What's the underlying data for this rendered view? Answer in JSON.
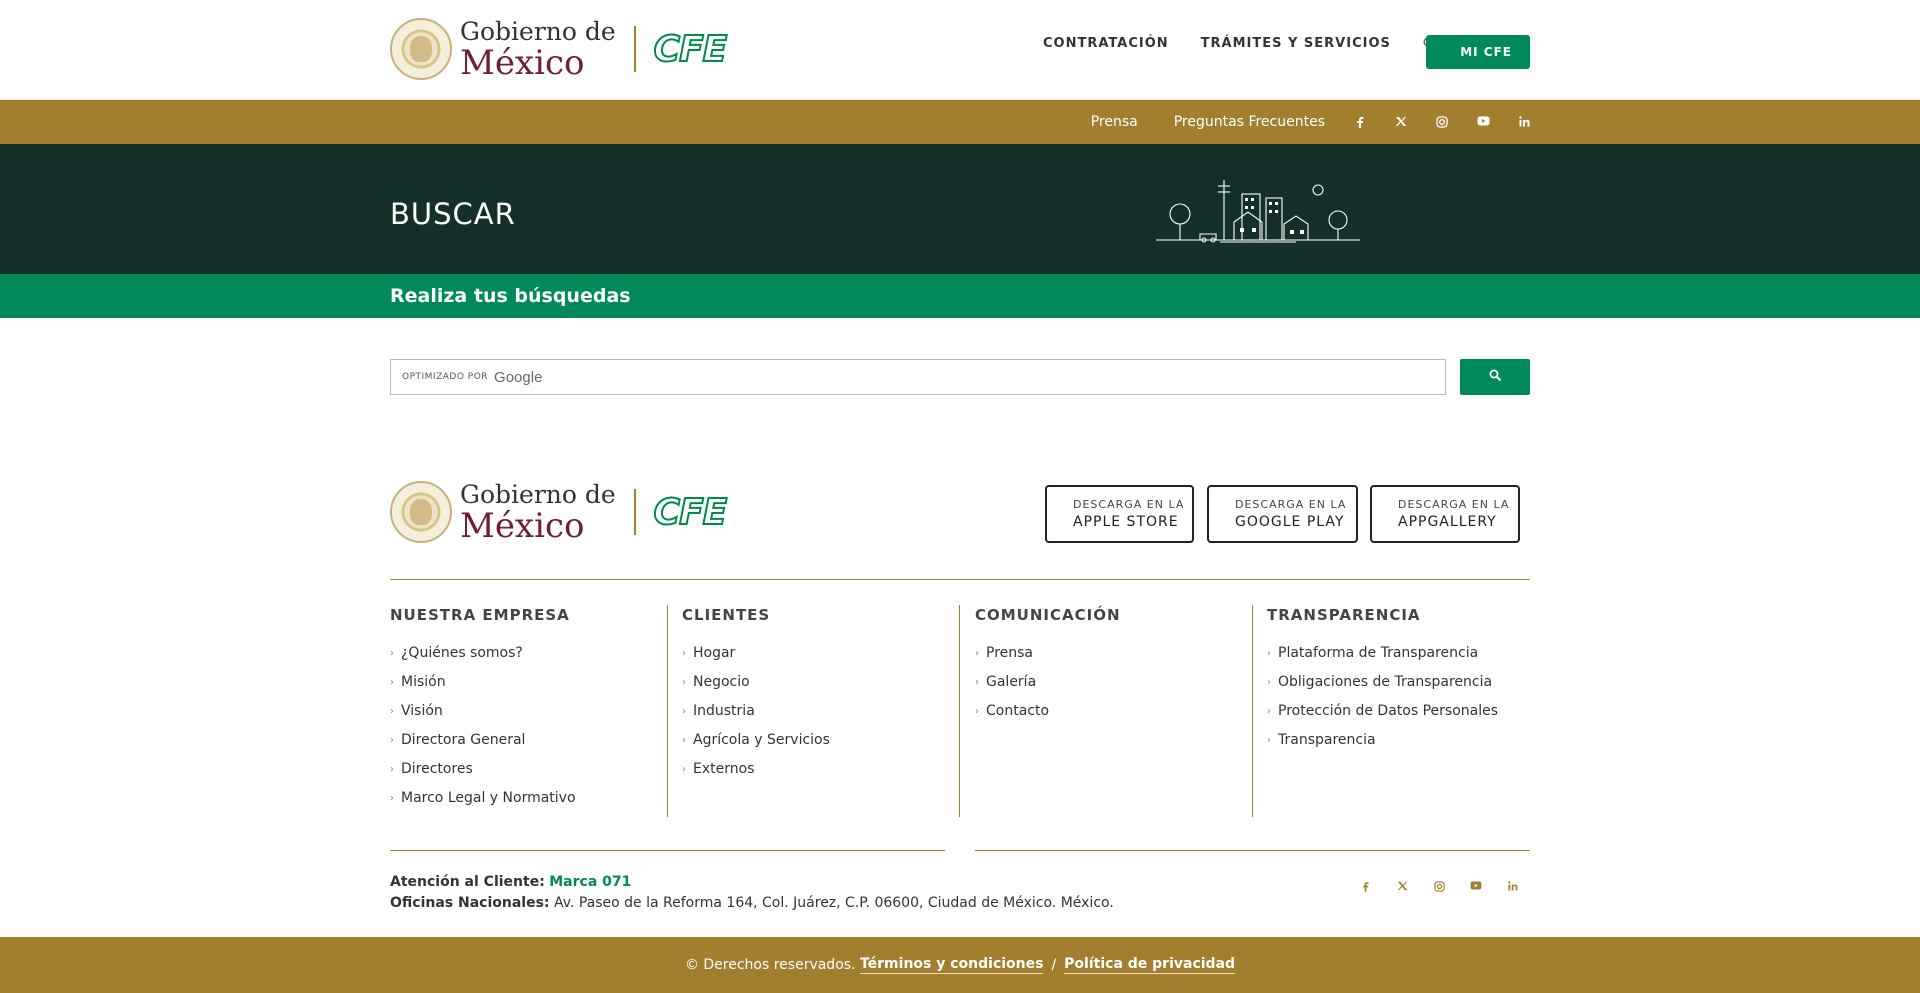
{
  "header": {
    "gob_line1": "Gobierno de",
    "gob_line2": "México",
    "cfe_logo": "CFE",
    "nav": [
      "CONTRATACIÓN",
      "TRÁMITES Y SERVICIOS"
    ],
    "search_icon": "search-icon",
    "mi_cfe": "MI CFE"
  },
  "goldbar": {
    "links": [
      "Prensa",
      "Preguntas Frecuentes"
    ],
    "social_icons": [
      "facebook-icon",
      "twitter-icon",
      "instagram-icon",
      "youtube-icon",
      "linkedin-icon"
    ]
  },
  "hero": {
    "title": "BUSCAR"
  },
  "subheader": {
    "title": "Realiza tus búsquedas"
  },
  "search": {
    "powered_by": "OPTIMIZADO POR",
    "brand": "Google",
    "button_icon": "search-icon"
  },
  "apps": [
    {
      "small": "DESCARGA EN LA",
      "big": "APPLE STORE"
    },
    {
      "small": "DESCARGA EN LA",
      "big": "GOOGLE PLAY"
    },
    {
      "small": "DESCARGA EN LA",
      "big": "APPGALLERY"
    }
  ],
  "footer_columns": [
    {
      "title": "NUESTRA EMPRESA",
      "items": [
        "¿Quiénes somos?",
        "Misión",
        "Visión",
        "Directora General",
        "Directores",
        "Marco Legal y Normativo"
      ]
    },
    {
      "title": "CLIENTES",
      "items": [
        "Hogar",
        "Negocio",
        "Industria",
        "Agrícola y Servicios",
        "Externos"
      ]
    },
    {
      "title": "COMUNICACIÓN",
      "items": [
        "Prensa",
        "Galería",
        "Contacto"
      ]
    },
    {
      "title": "TRANSPARENCIA",
      "items": [
        "Plataforma de Transparencia",
        "Obligaciones de Transparencia",
        "Protección de Datos Personales",
        "Transparencia"
      ]
    }
  ],
  "contact": {
    "attention_label": "Atención al Cliente:",
    "attention_value": "Marca 071",
    "offices_label": "Oficinas Nacionales:",
    "offices_value": "Av. Paseo de la Reforma 164, Col. Juárez, C.P. 06600, Ciudad de México. México."
  },
  "bottom": {
    "rights": "© Derechos reservados.",
    "terms": "Términos y condiciones",
    "separator": "/",
    "privacy": "Política de privacidad"
  },
  "colors": {
    "gold": "#a27f2e",
    "green": "#008a5a",
    "dark": "#13302b",
    "maroon": "#6f1d38"
  }
}
